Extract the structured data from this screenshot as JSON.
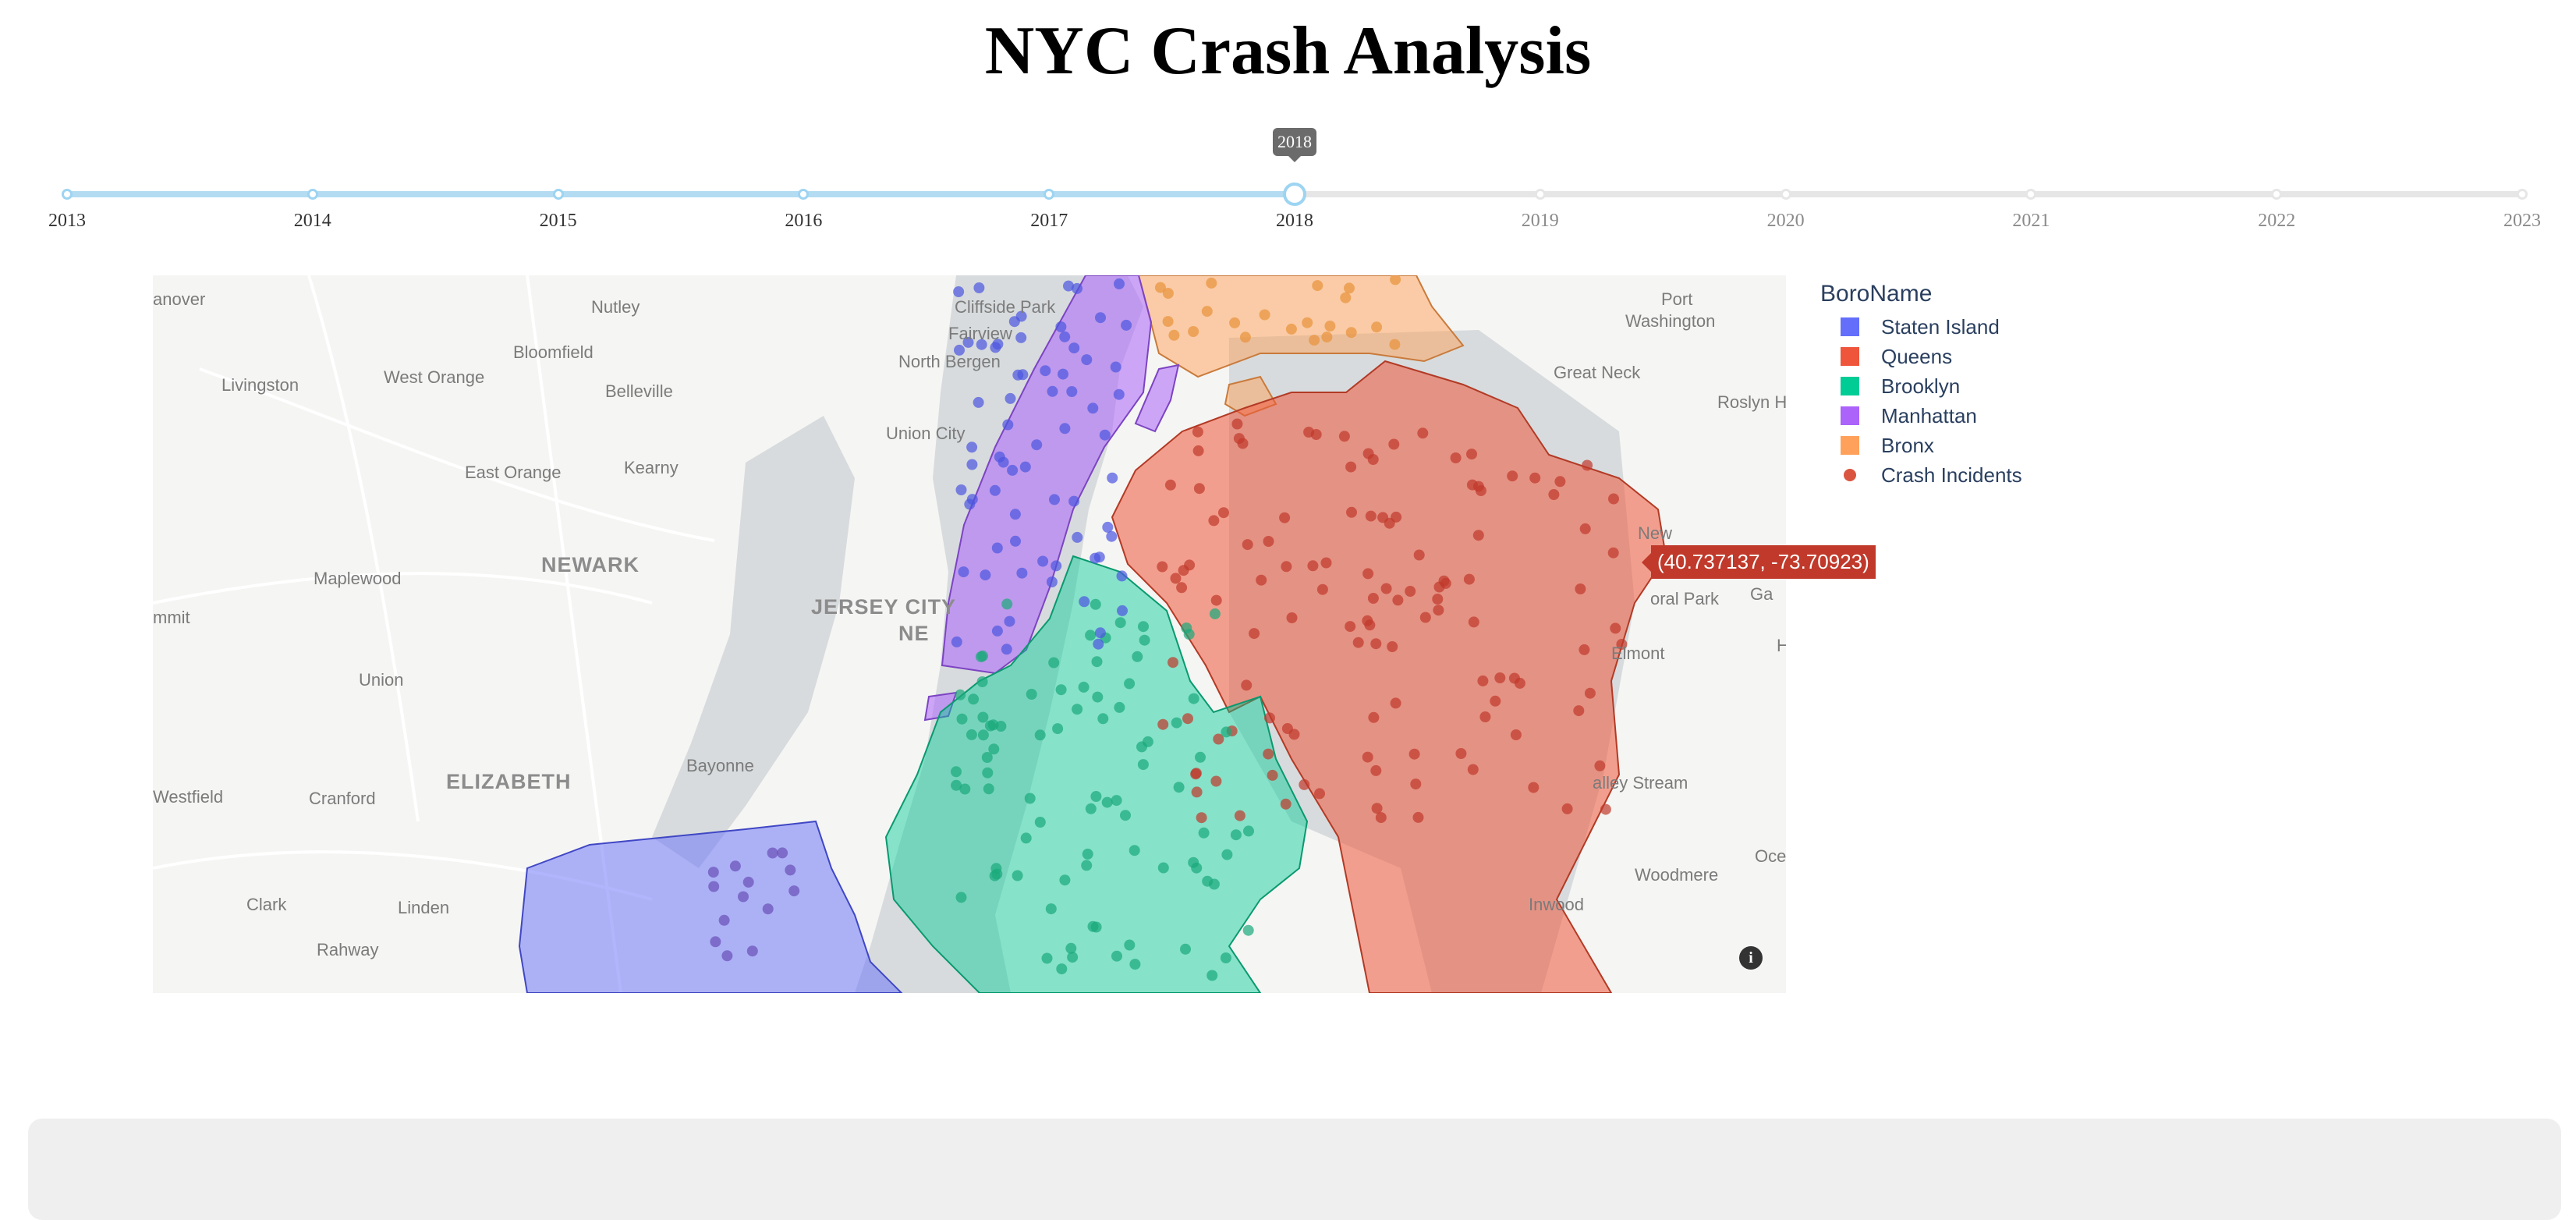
{
  "page": {
    "title": "NYC Crash Analysis"
  },
  "slider": {
    "marks": [
      "2013",
      "2014",
      "2015",
      "2016",
      "2017",
      "2018",
      "2019",
      "2020",
      "2021",
      "2022",
      "2023"
    ],
    "selected_index": 5,
    "tooltip": "2018"
  },
  "map": {
    "hover_label": "(40.737137, -73.70923)",
    "info_icon": "info-icon",
    "places": [
      {
        "id": "hanover",
        "text": "anover"
      },
      {
        "id": "nutley",
        "text": "Nutley"
      },
      {
        "id": "cliffside",
        "text": "Cliffside Park"
      },
      {
        "id": "fairview",
        "text": "Fairview"
      },
      {
        "id": "port",
        "text": "Port"
      },
      {
        "id": "washington",
        "text": "Washington"
      },
      {
        "id": "bloomfield",
        "text": "Bloomfield"
      },
      {
        "id": "northbergen",
        "text": "North Bergen"
      },
      {
        "id": "livingston",
        "text": "Livingston"
      },
      {
        "id": "westorange",
        "text": "West Orange"
      },
      {
        "id": "belleville",
        "text": "Belleville"
      },
      {
        "id": "greatneck",
        "text": "Great Neck"
      },
      {
        "id": "roslyn",
        "text": "Roslyn H"
      },
      {
        "id": "unioncity",
        "text": "Union City"
      },
      {
        "id": "eastorange",
        "text": "East Orange"
      },
      {
        "id": "kearny",
        "text": "Kearny"
      },
      {
        "id": "newark",
        "text": "NEWARK"
      },
      {
        "id": "maplewood",
        "text": "Maplewood"
      },
      {
        "id": "jerseycity",
        "text": "JERSEY CITY"
      },
      {
        "id": "newyork",
        "text": "NE"
      },
      {
        "id": "newnew",
        "text": "New"
      },
      {
        "id": "summit",
        "text": "mmit"
      },
      {
        "id": "floral",
        "text": "oral Park"
      },
      {
        "id": "ga",
        "text": "Ga"
      },
      {
        "id": "union",
        "text": "Union"
      },
      {
        "id": "elmont",
        "text": "Elmont"
      },
      {
        "id": "h",
        "text": "H"
      },
      {
        "id": "bayonne",
        "text": "Bayonne"
      },
      {
        "id": "elizabeth",
        "text": "ELIZABETH"
      },
      {
        "id": "valley",
        "text": "alley Stream"
      },
      {
        "id": "westfield",
        "text": "Westfield"
      },
      {
        "id": "cranford",
        "text": "Cranford"
      },
      {
        "id": "woodmere",
        "text": "Woodmere"
      },
      {
        "id": "oce",
        "text": "Oce"
      },
      {
        "id": "clark",
        "text": "Clark"
      },
      {
        "id": "linden",
        "text": "Linden"
      },
      {
        "id": "inwood",
        "text": "Inwood"
      },
      {
        "id": "rahway",
        "text": "Rahway"
      }
    ]
  },
  "legend": {
    "title": "BoroName",
    "items": [
      {
        "label": "Staten Island",
        "color": "#636efa",
        "kind": "area"
      },
      {
        "label": "Queens",
        "color": "#ef553b",
        "kind": "area"
      },
      {
        "label": "Brooklyn",
        "color": "#00cc96",
        "kind": "area"
      },
      {
        "label": "Manhattan",
        "color": "#ab63fa",
        "kind": "area"
      },
      {
        "label": "Bronx",
        "color": "#ffa15a",
        "kind": "area"
      },
      {
        "label": "Crash Incidents",
        "color": "#d9553f",
        "kind": "point"
      }
    ]
  }
}
